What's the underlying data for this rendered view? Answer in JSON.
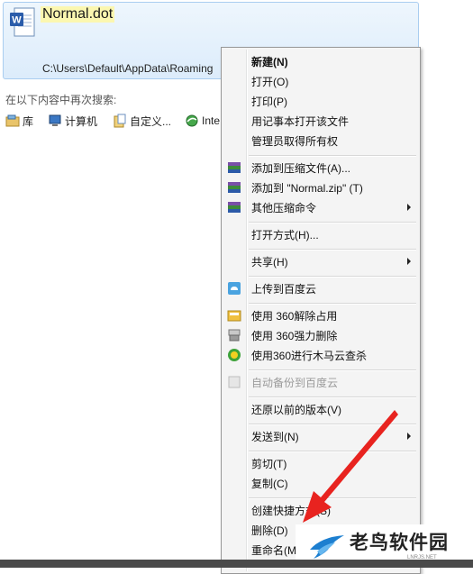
{
  "result": {
    "filename": "Normal.dot",
    "path": "C:\\Users\\Default\\AppData\\Roaming"
  },
  "search_again": {
    "label": "在以下内容中再次搜索:",
    "locations": [
      {
        "label": "库",
        "icon": "library-icon"
      },
      {
        "label": "计算机",
        "icon": "computer-icon"
      },
      {
        "label": "自定义...",
        "icon": "custom-folder-icon"
      },
      {
        "label": "Inte",
        "icon": "internet-icon"
      }
    ]
  },
  "context_menu": {
    "items": [
      {
        "label": "新建(N)",
        "bold": true
      },
      {
        "label": "打开(O)"
      },
      {
        "label": "打印(P)"
      },
      {
        "label": "用记事本打开该文件"
      },
      {
        "label": "管理员取得所有权"
      },
      {
        "label": "添加到压缩文件(A)...",
        "icon": "winrar-icon"
      },
      {
        "label": "添加到 \"Normal.zip\" (T)",
        "icon": "winrar-icon"
      },
      {
        "label": "其他压缩命令",
        "icon": "winrar-icon",
        "submenu": true
      },
      {
        "label": "打开方式(H)..."
      },
      {
        "label": "共享(H)",
        "submenu": true
      },
      {
        "label": "上传到百度云",
        "icon": "baidu-cloud-icon"
      },
      {
        "label": "使用 360解除占用",
        "icon": "unlock-360-icon"
      },
      {
        "label": "使用 360强力删除",
        "icon": "shred-360-icon"
      },
      {
        "label": "使用360进行木马云查杀",
        "icon": "scan-360-icon"
      },
      {
        "label": "自动备份到百度云",
        "icon": "baidu-backup-icon",
        "disabled": true
      },
      {
        "label": "还原以前的版本(V)"
      },
      {
        "label": "发送到(N)",
        "submenu": true
      },
      {
        "label": "剪切(T)"
      },
      {
        "label": "复制(C)"
      },
      {
        "label": "创建快捷方式(S)"
      },
      {
        "label": "删除(D)"
      },
      {
        "label": "重命名(M)"
      }
    ]
  },
  "watermark": {
    "text": "老鸟软件园",
    "subtext": "LNRJS.NET"
  },
  "colors": {
    "selection_bg": "#dcecfb",
    "highlight": "#fbf7b0",
    "arrow": "#e8231f"
  }
}
